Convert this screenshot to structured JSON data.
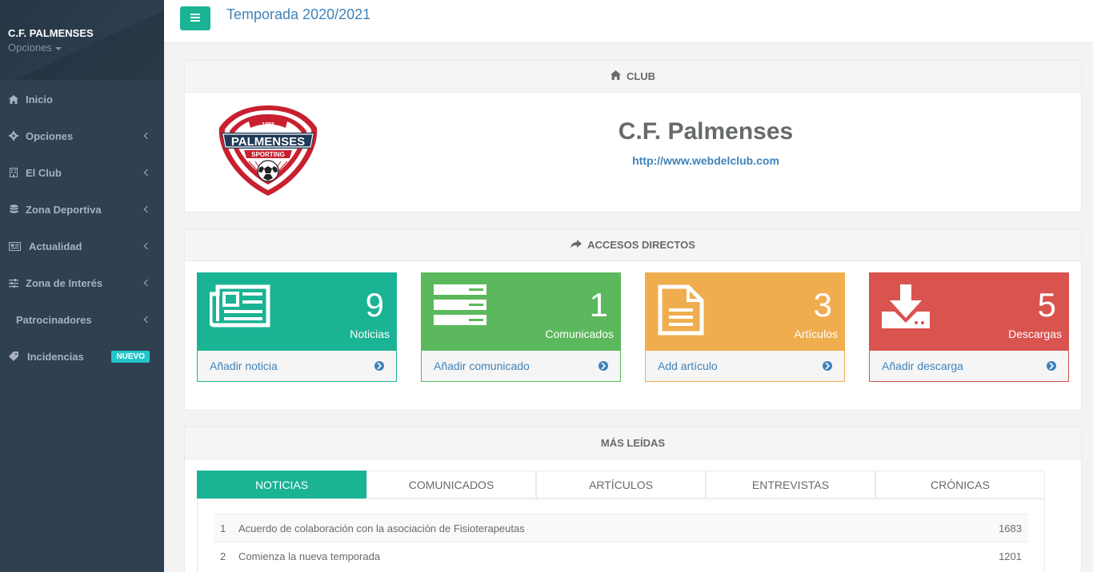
{
  "sidebar": {
    "club_name": "C.F. PALMENSES",
    "options_label": "Opciones",
    "items": [
      {
        "label": "Inicio",
        "icon": "home-icon"
      },
      {
        "label": "Opciones",
        "icon": "gear-icon"
      },
      {
        "label": "El Club",
        "icon": "building-icon"
      },
      {
        "label": "Zona Deportiva",
        "icon": "database-icon"
      },
      {
        "label": "Actualidad",
        "icon": "newspaper-icon"
      },
      {
        "label": "Zona de Interés",
        "icon": "sliders-icon"
      },
      {
        "label": "Patrocinadores",
        "icon": ""
      },
      {
        "label": "Incidencias",
        "icon": "tag-icon",
        "badge": "NUEVO"
      }
    ]
  },
  "header": {
    "season": "Temporada 2020/2021"
  },
  "club_panel": {
    "title": "CLUB",
    "name": "C.F. Palmenses",
    "website": "http://www.webdelclub.com",
    "logo": {
      "year": "1958",
      "name": "PALMENSES",
      "sub": "SPORTING"
    }
  },
  "shortcuts": {
    "title": "ACCESOS DIRECTOS",
    "widgets": [
      {
        "count": "9",
        "label": "Noticias",
        "action": "Añadir noticia",
        "color": "#1ab394",
        "icon": "newspaper-icon"
      },
      {
        "count": "1",
        "label": "Comunicados",
        "action": "Añadir comunicado",
        "color": "#5cb85c",
        "icon": "server-icon"
      },
      {
        "count": "3",
        "label": "Artículos",
        "action": "Add artículo",
        "color": "#f0ad4e",
        "icon": "file-text-icon"
      },
      {
        "count": "5",
        "label": "Descargas",
        "action": "Añadir descarga",
        "color": "#d9534f",
        "icon": "download-icon"
      }
    ]
  },
  "most_read": {
    "title": "MÁS LEÍDAS",
    "tabs": [
      "NOTICIAS",
      "COMUNICADOS",
      "ARTÍCULOS",
      "ENTREVISTAS",
      "CRÓNICAS"
    ],
    "active_tab": "NOTICIAS",
    "rows": [
      {
        "num": "1",
        "title": "Acuerdo de colaboración con la asociación de Fisioterapeutas",
        "count": "1683"
      },
      {
        "num": "2",
        "title": "Comienza la nueva temporada",
        "count": "1201"
      }
    ]
  },
  "colors": {
    "primary": "#1ab394",
    "link": "#3f82b9",
    "sidebar": "#2f4050",
    "badge": "#23c6c8"
  }
}
